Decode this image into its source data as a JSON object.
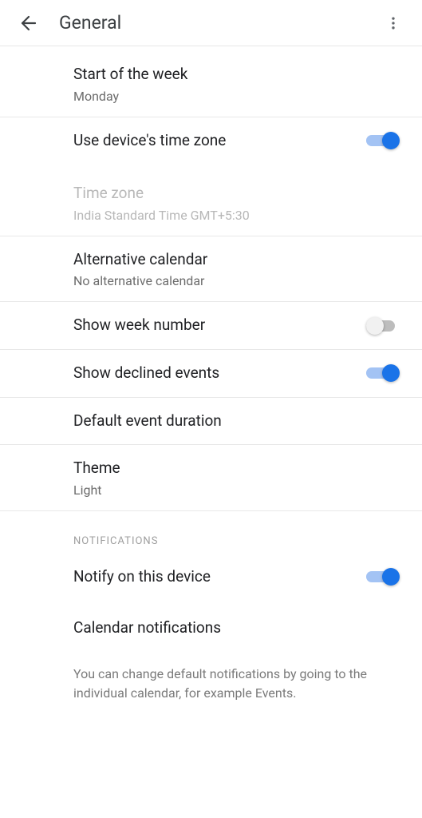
{
  "header": {
    "title": "General"
  },
  "rows": {
    "start_week": {
      "title": "Start of the week",
      "sub": "Monday"
    },
    "device_tz": {
      "title": "Use device's time zone",
      "on": true
    },
    "tz": {
      "title": "Time zone",
      "sub": "India Standard Time  GMT+5:30"
    },
    "alt_cal": {
      "title": "Alternative calendar",
      "sub": "No alternative calendar"
    },
    "week_num": {
      "title": "Show week number",
      "on": false
    },
    "declined": {
      "title": "Show declined events",
      "on": true
    },
    "duration": {
      "title": "Default event duration"
    },
    "theme": {
      "title": "Theme",
      "sub": "Light"
    },
    "section_notifications": "Notifications",
    "notify_device": {
      "title": "Notify on this device",
      "on": true
    },
    "cal_notifications": {
      "title": "Calendar notifications"
    },
    "hint": "You can change default notifications by going to the individual calendar, for example Events."
  }
}
